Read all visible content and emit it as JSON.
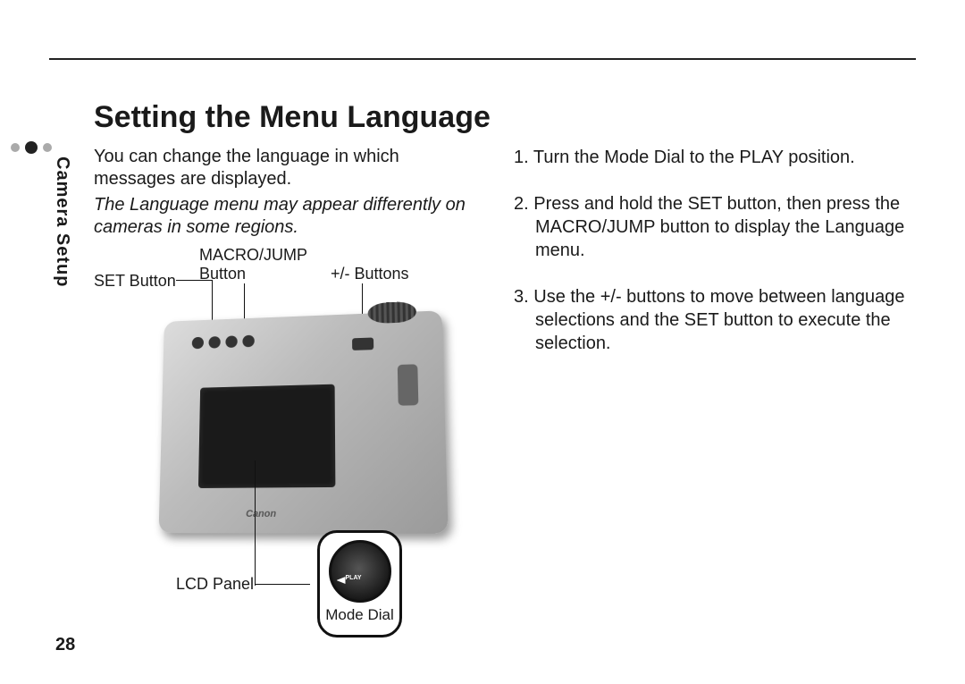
{
  "page_number": "28",
  "sidebar": {
    "section_label": "Camera Setup"
  },
  "heading": "Setting the Menu Language",
  "intro": "You can change the language in which messages are displayed.",
  "note": "The Language menu may appear differently on cameras in some regions.",
  "diagram": {
    "set_button_label": "SET Button",
    "macro_jump_label": "MACRO/JUMP\nButton",
    "plus_minus_label": "+/- Buttons",
    "lcd_panel_label": "LCD Panel",
    "mode_dial_caption": "Mode Dial",
    "mode_dial_play_text": "PLAY",
    "camera_brand": "Canon"
  },
  "steps": [
    "Turn the Mode Dial to the PLAY position.",
    "Press and hold the SET button, then press the MACRO/JUMP button to display the Language menu.",
    "Use the +/- buttons to move between language selections and the SET button to execute the selection."
  ]
}
